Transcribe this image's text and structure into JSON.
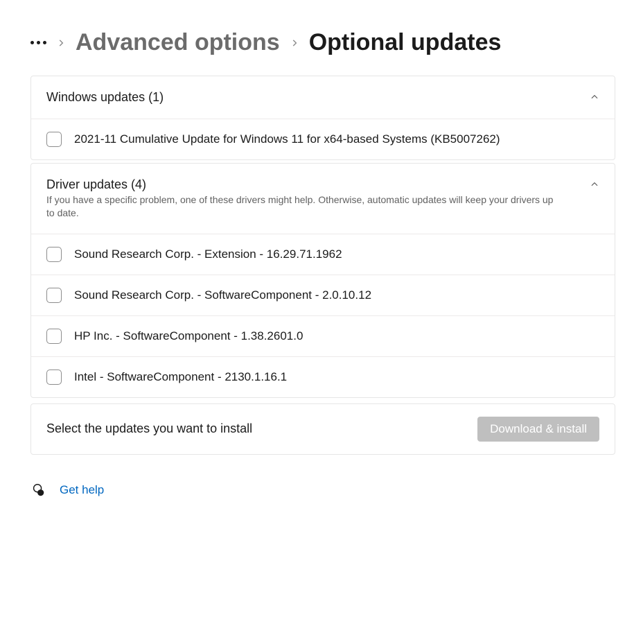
{
  "breadcrumb": {
    "prev": "Advanced options",
    "current": "Optional updates"
  },
  "sections": [
    {
      "title": "Windows updates (1)",
      "subtitle": "",
      "items": [
        "2021-11 Cumulative Update for Windows 11 for x64-based Systems (KB5007262)"
      ]
    },
    {
      "title": "Driver updates (4)",
      "subtitle": "If you have a specific problem, one of these drivers might help. Otherwise, automatic updates will keep your drivers up to date.",
      "items": [
        "Sound Research Corp. - Extension - 16.29.71.1962",
        "Sound Research Corp. - SoftwareComponent - 2.0.10.12",
        "HP Inc. - SoftwareComponent - 1.38.2601.0",
        "Intel - SoftwareComponent - 2130.1.16.1"
      ]
    }
  ],
  "action": {
    "hint": "Select the updates you want to install",
    "button": "Download & install"
  },
  "help": {
    "label": "Get help"
  }
}
